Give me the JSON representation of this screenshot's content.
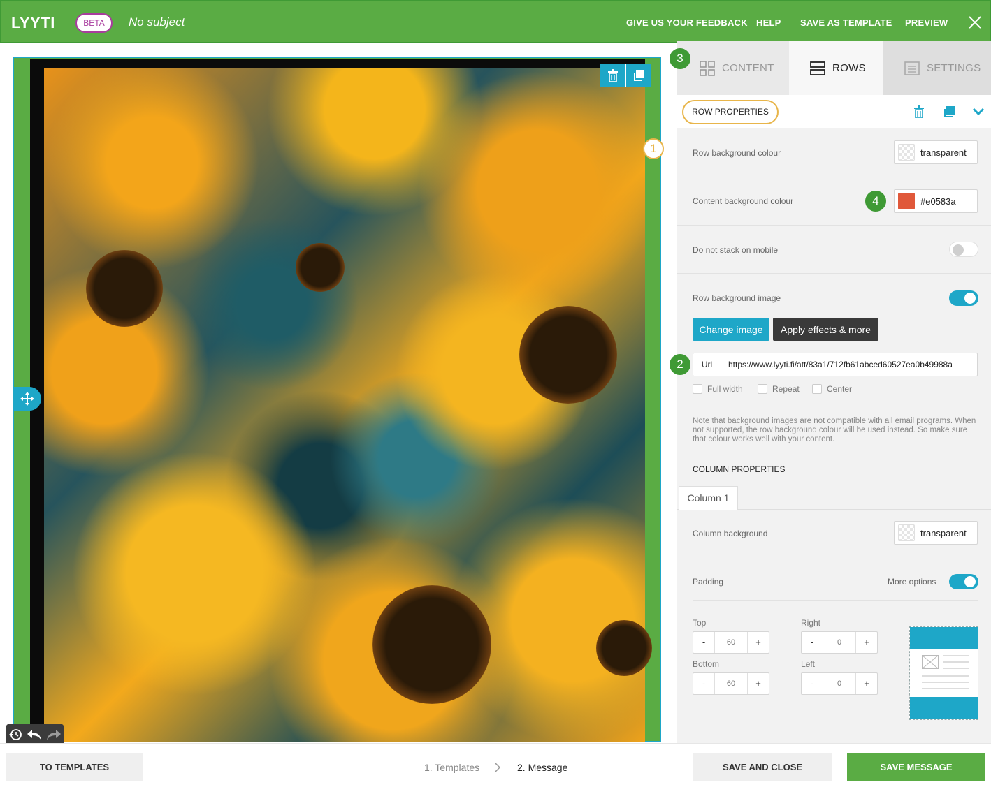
{
  "header": {
    "logo": "LYYTI",
    "beta": "BETA",
    "subject": "No subject",
    "nav": [
      "GIVE US YOUR FEEDBACK",
      "HELP",
      "SAVE AS TEMPLATE",
      "PREVIEW"
    ]
  },
  "markers": {
    "m1": "1",
    "m2": "2",
    "m3": "3",
    "m4": "4"
  },
  "tabs": {
    "content": "CONTENT",
    "rows": "ROWS",
    "settings": "SETTINGS"
  },
  "row_properties": {
    "title": "ROW PROPERTIES",
    "row_bg_label": "Row background colour",
    "row_bg_value": "transparent",
    "content_bg_label": "Content background colour",
    "content_bg_value": "#e0583a",
    "content_bg_color": "#e0583a",
    "no_stack_label": "Do not stack on mobile",
    "no_stack_on": false,
    "bg_image_label": "Row background image",
    "bg_image_on": true,
    "change_image": "Change image",
    "apply_effects": "Apply effects & more",
    "url_label": "Url",
    "url_value": "https://www.lyyti.fi/att/83a1/712fb61abced60527ea0b49988a",
    "full_width": "Full width",
    "repeat": "Repeat",
    "center": "Center",
    "note": "Note that background images are not compatible with all email programs. When not supported, the row background colour will be used instead. So make sure that colour works well with your content."
  },
  "column_properties": {
    "title": "COLUMN PROPERTIES",
    "tab": "Column 1",
    "col_bg_label": "Column background",
    "col_bg_value": "transparent",
    "padding_label": "Padding",
    "more_options": "More options",
    "more_options_on": true,
    "top_label": "Top",
    "top_value": "60",
    "right_label": "Right",
    "right_value": "0",
    "bottom_label": "Bottom",
    "bottom_value": "60",
    "left_label": "Left",
    "left_value": "0",
    "minus": "-",
    "plus": "+"
  },
  "footer": {
    "to_templates": "TO TEMPLATES",
    "step1": "1. Templates",
    "step2": "2. Message",
    "save_close": "SAVE AND CLOSE",
    "save_message": "SAVE MESSAGE"
  },
  "colors": {
    "brand_green": "#5aac44",
    "accent_cyan": "#1ea7c8",
    "marker_outline": "#e8b54a"
  }
}
